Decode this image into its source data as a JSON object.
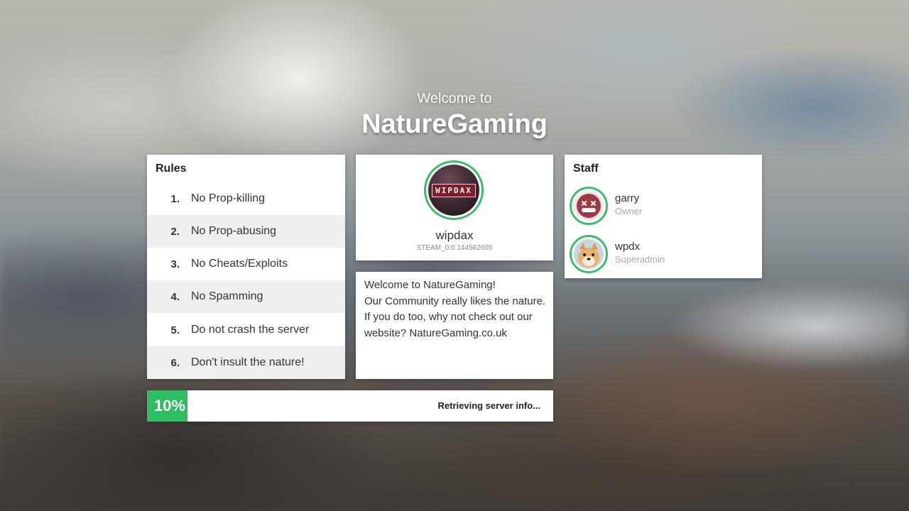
{
  "header": {
    "welcome": "Welcome to",
    "brand": "NatureGaming"
  },
  "rules": {
    "title": "Rules",
    "items": [
      {
        "num": "1.",
        "text": "No Prop-killing"
      },
      {
        "num": "2.",
        "text": "No Prop-abusing"
      },
      {
        "num": "3.",
        "text": "No Cheats/Exploits"
      },
      {
        "num": "4.",
        "text": "No Spamming"
      },
      {
        "num": "5.",
        "text": "Do not crash the server"
      },
      {
        "num": "6.",
        "text": "Don't insult the nature!"
      }
    ]
  },
  "profile": {
    "avatar_text": "WIPDAX",
    "name": "wipdax",
    "steam_id": "STEAM_0:0:144562605"
  },
  "message": {
    "lines": [
      "Welcome to NatureGaming!",
      "Our Community really likes the nature.",
      "If you do too, why not check out our",
      "website? NatureGaming.co.uk"
    ]
  },
  "staff": {
    "title": "Staff",
    "members": [
      {
        "name": "garry",
        "role": "Owner",
        "avatar_icon": "dead-face-icon"
      },
      {
        "name": "wpdx",
        "role": "Superadmin",
        "avatar_icon": "dog-avatar-icon"
      }
    ]
  },
  "loading": {
    "percent_label": "10%",
    "progress": 0.1,
    "status": "Retrieving server info..."
  },
  "colors": {
    "accent": "#2fbf63",
    "ring": "#3ebb6b",
    "panel": "#ffffff",
    "row_alt": "#efefef"
  }
}
